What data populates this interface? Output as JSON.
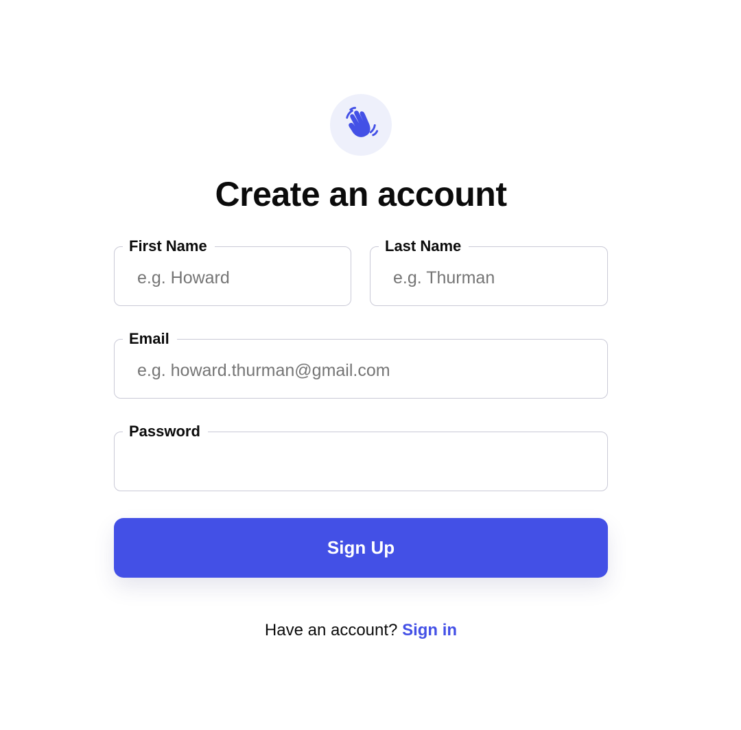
{
  "logo": {
    "icon": "waving-hand-icon",
    "accent": "#4350e6",
    "background": "#eef0fb"
  },
  "title": "Create an account",
  "form": {
    "first_name": {
      "label": "First Name",
      "placeholder": "e.g. Howard",
      "value": ""
    },
    "last_name": {
      "label": "Last Name",
      "placeholder": "e.g. Thurman",
      "value": ""
    },
    "email": {
      "label": "Email",
      "placeholder": "e.g. howard.thurman@gmail.com",
      "value": ""
    },
    "password": {
      "label": "Password",
      "placeholder": "",
      "value": ""
    },
    "submit_label": "Sign Up"
  },
  "footer": {
    "prompt": "Have an account?",
    "link_label": "Sign in"
  },
  "colors": {
    "primary": "#4350e6",
    "text": "#0b0b0b",
    "placeholder": "#757575",
    "border": "#c9c9d6"
  }
}
